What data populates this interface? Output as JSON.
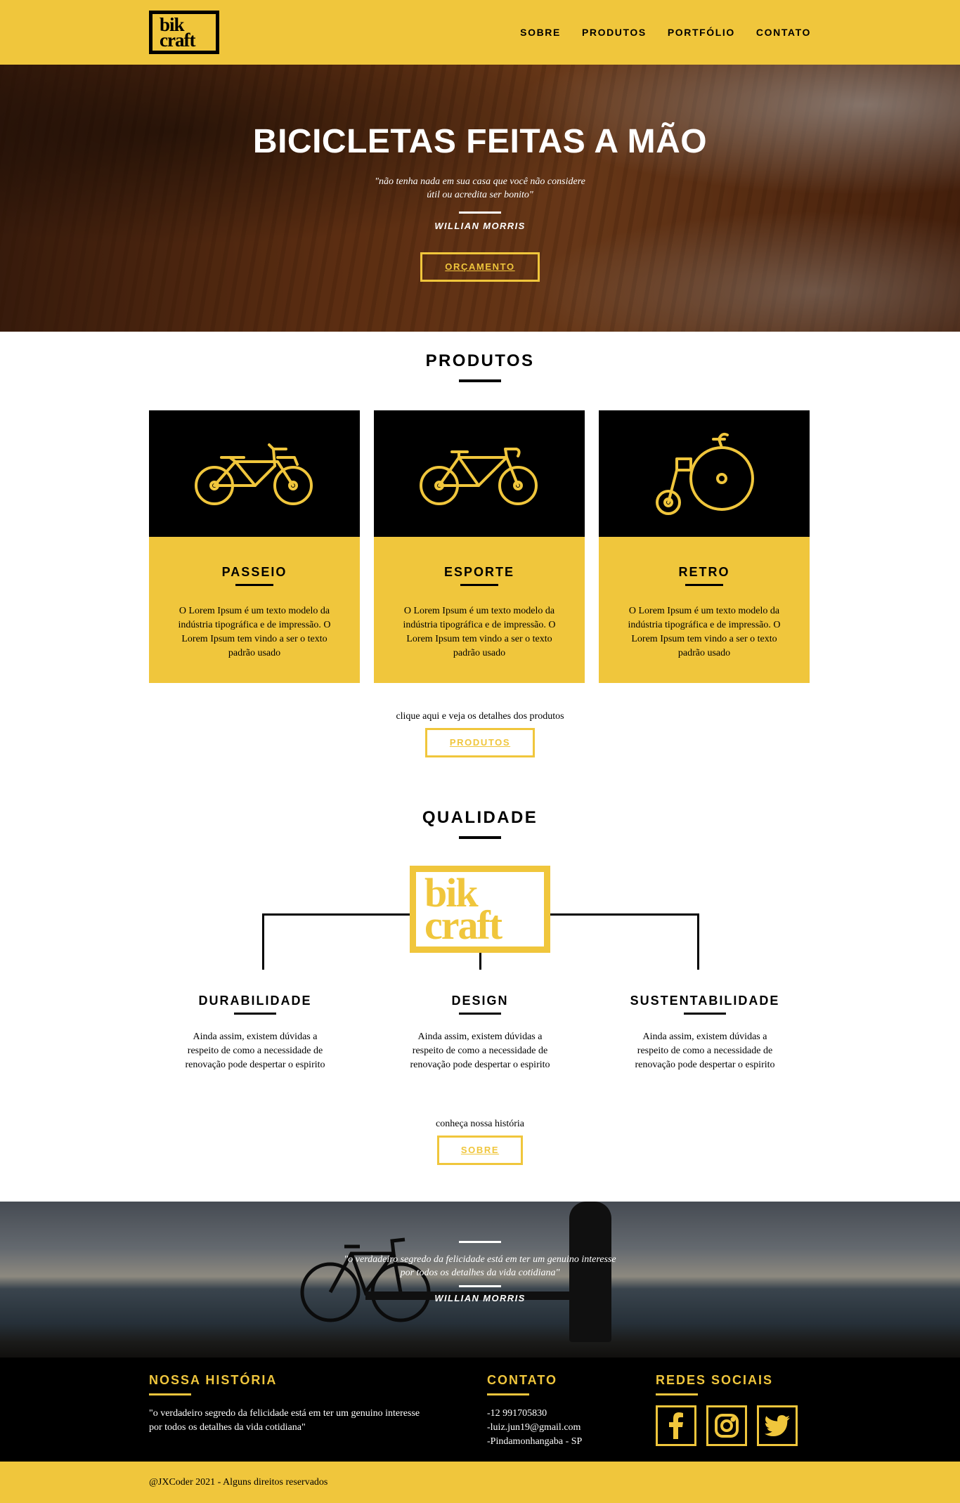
{
  "logo": {
    "line1": "bik",
    "line2": "craft"
  },
  "nav": [
    "SOBRE",
    "PRODUTOS",
    "PORTFÓLIO",
    "CONTATO"
  ],
  "hero": {
    "title": "BICICLETAS FEITAS A MÃO",
    "quote": "\"não tenha nada em sua casa que você não considere útil ou acredita ser bonito\"",
    "author": "WILLIAN MORRIS",
    "button": "ORÇAMENTO"
  },
  "produtos": {
    "title": "PRODUTOS",
    "cards": [
      {
        "title": "PASSEIO",
        "text": "O Lorem Ipsum é um texto modelo da indústria tipográfica e de impressão. O Lorem Ipsum tem vindo a ser o texto padrão usado",
        "icon": "city-bike-icon"
      },
      {
        "title": "ESPORTE",
        "text": "O Lorem Ipsum é um texto modelo da indústria tipográfica e de impressão. O Lorem Ipsum tem vindo a ser o texto padrão usado",
        "icon": "sport-bike-icon"
      },
      {
        "title": "RETRO",
        "text": "O Lorem Ipsum é um texto modelo da indústria tipográfica e de impressão. O Lorem Ipsum tem vindo a ser o texto padrão usado",
        "icon": "penny-farthing-icon"
      }
    ],
    "note": "clique aqui e veja os detalhes dos produtos",
    "button": "PRODUTOS"
  },
  "qualidade": {
    "title": "QUALIDADE",
    "logo": {
      "line1": "bik",
      "line2": "craft"
    },
    "items": [
      {
        "title": "DURABILIDADE",
        "text": "Ainda assim, existem dúvidas a respeito de como a necessidade de renovação pode despertar o espirito"
      },
      {
        "title": "DESIGN",
        "text": "Ainda assim, existem dúvidas a respeito de como a necessidade de renovação pode despertar o espirito"
      },
      {
        "title": "SUSTENTABILIDADE",
        "text": "Ainda assim, existem dúvidas a respeito de como a necessidade de renovação pode despertar o espirito"
      }
    ],
    "note": "conheça nossa história",
    "button": "SOBRE"
  },
  "band": {
    "quote": "\"o verdadeiro segredo da felicidade está em ter um genuino interesse por todos os detalhes da vida cotidiana\"",
    "author": "WILLIAN MORRIS"
  },
  "footer": {
    "historia_title": "NOSSA HISTÓRIA",
    "historia_text": "\"o verdadeiro segredo da felicidade está em ter um genuino interesse por todos os detalhes da vida cotidiana\"",
    "contato_title": "CONTATO",
    "contato": [
      "-12 991705830",
      "-luiz.jun19@gmail.com",
      "-Pindamonhangaba - SP"
    ],
    "redes_title": "REDES SOCIAIS",
    "redes": [
      "facebook-icon",
      "instagram-icon",
      "twitter-icon"
    ]
  },
  "copyright": "@JXCoder 2021 - Alguns direitos reservados",
  "colors": {
    "accent": "#f0c63c",
    "dark": "#000000"
  }
}
